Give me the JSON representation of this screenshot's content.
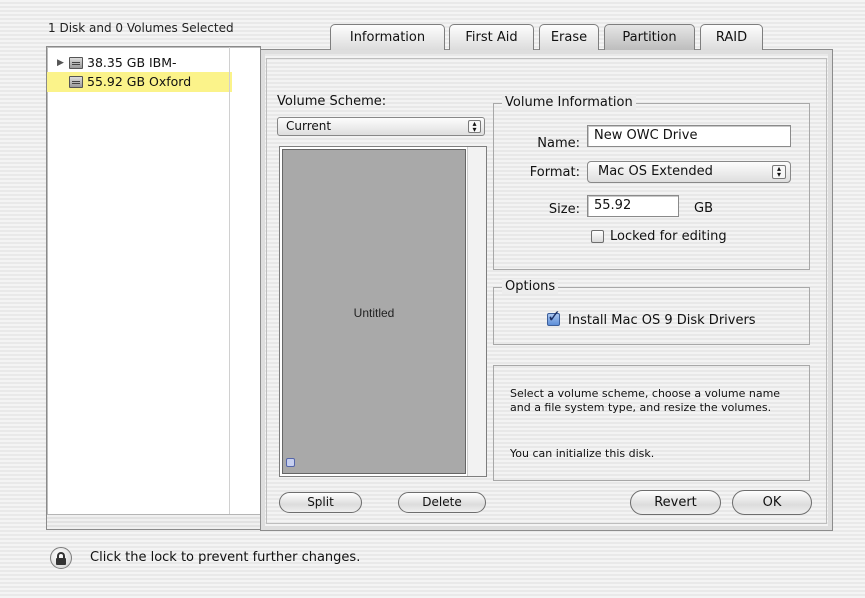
{
  "left_panel": {
    "selection_label": "1 Disk and 0 Volumes Selected",
    "disks": [
      {
        "label": "38.35 GB IBM-",
        "selected": false,
        "disclosure": "▶"
      },
      {
        "label": "55.92 GB Oxford",
        "selected": true
      }
    ]
  },
  "tabs": [
    {
      "label": "Information",
      "active": false
    },
    {
      "label": "First Aid",
      "active": false
    },
    {
      "label": "Erase",
      "active": false
    },
    {
      "label": "Partition",
      "active": true
    },
    {
      "label": "RAID",
      "active": false
    }
  ],
  "partition": {
    "volume_scheme_label": "Volume Scheme:",
    "volume_scheme_value": "Current",
    "volume_name_in_map": "Untitled",
    "volume_info": {
      "title": "Volume Information",
      "name_label": "Name:",
      "name_value": "New OWC Drive",
      "format_label": "Format:",
      "format_value": "Mac OS Extended",
      "size_label": "Size:",
      "size_value": "55.92",
      "size_unit": "GB",
      "locked_label": "Locked for editing",
      "locked_checked": false
    },
    "options": {
      "title": "Options",
      "install_drivers_label": "Install Mac OS 9 Disk Drivers",
      "install_drivers_checked": true
    },
    "help": {
      "line1": "Select a volume scheme, choose a volume name and a file system type, and resize the volumes.",
      "line2": "You can initialize this disk."
    },
    "buttons": {
      "split": "Split",
      "delete": "Delete",
      "revert": "Revert",
      "ok": "OK"
    }
  },
  "footer": {
    "lock_text": "Click the lock to prevent further changes."
  },
  "icons": [
    "disk-icon",
    "lock-icon",
    "disclosure-triangle-icon",
    "popup-arrows-icon",
    "checkmark-icon"
  ]
}
